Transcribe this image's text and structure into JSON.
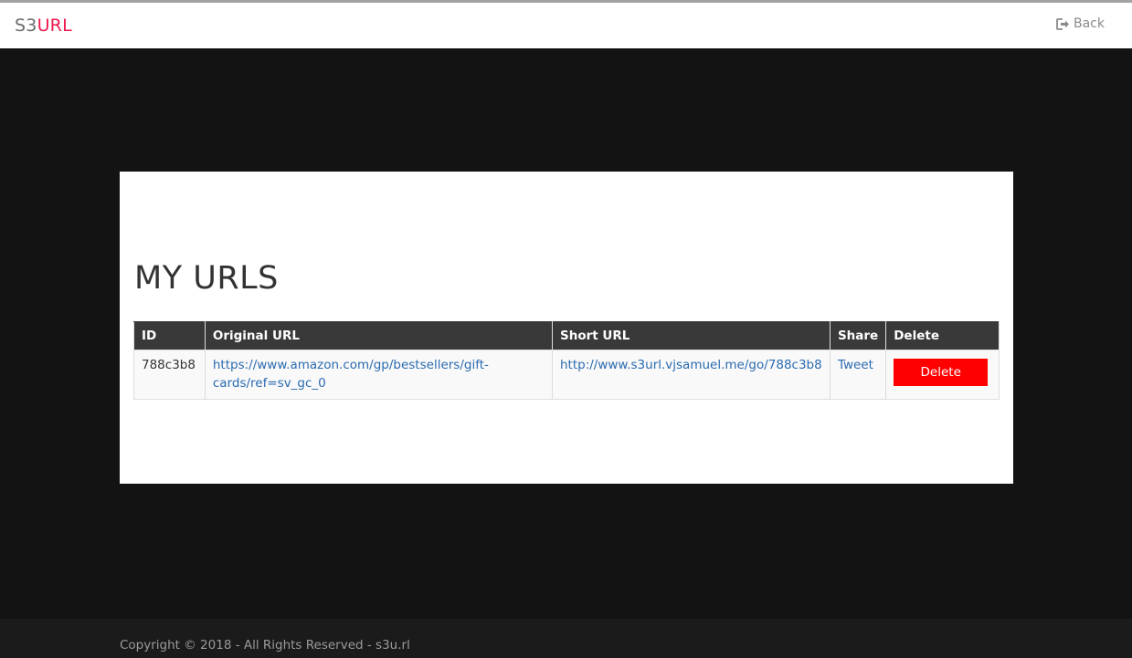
{
  "navbar": {
    "brand_part1": "S3",
    "brand_part2": "URL",
    "back_label": "Back",
    "back_icon": "sign-out-icon"
  },
  "colors": {
    "brand_accent": "#ee1a4e",
    "page_background": "#131313",
    "table_header": "#393939",
    "link": "#2b6bb0",
    "delete_button": "#ff0000"
  },
  "main": {
    "title": "MY URLS",
    "table": {
      "headers": [
        "ID",
        "Original URL",
        "Short URL",
        "Share",
        "Delete"
      ],
      "rows": [
        {
          "id": "788c3b8",
          "original_url": "https://www.amazon.com/gp/bestsellers/gift-cards/ref=sv_gc_0",
          "short_url": "http://www.s3url.vjsamuel.me/go/788c3b8",
          "share_label": "Tweet",
          "delete_label": "Delete"
        }
      ]
    }
  },
  "footer": {
    "copyright": "Copyright © 2018 - All Rights Reserved - s3u.rl"
  }
}
